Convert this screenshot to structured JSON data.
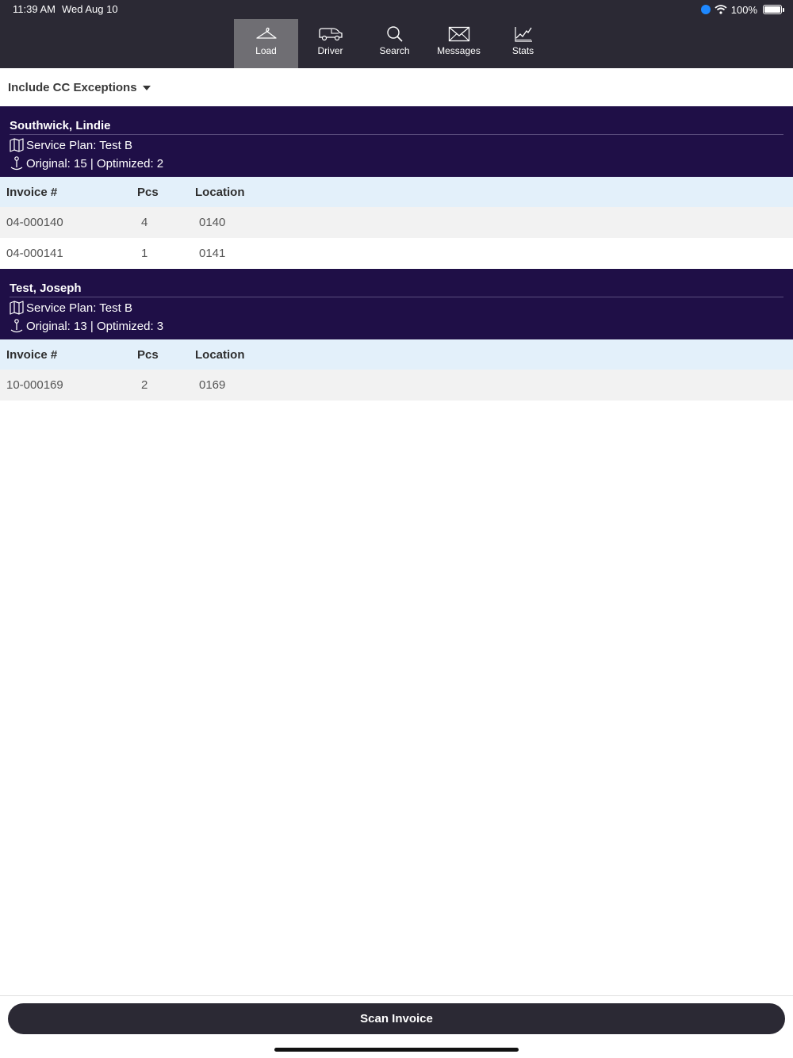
{
  "status_bar": {
    "time": "11:39 AM",
    "date": "Wed Aug 10",
    "battery": "100%"
  },
  "tabs": [
    {
      "label": "Load",
      "icon": "hanger-icon",
      "active": true
    },
    {
      "label": "Driver",
      "icon": "van-icon",
      "active": false
    },
    {
      "label": "Search",
      "icon": "search-icon",
      "active": false
    },
    {
      "label": "Messages",
      "icon": "envelope-icon",
      "active": false
    },
    {
      "label": "Stats",
      "icon": "chart-icon",
      "active": false
    }
  ],
  "filter": {
    "label": "Include CC Exceptions"
  },
  "columns": {
    "invoice": "Invoice #",
    "pcs": "Pcs",
    "location": "Location"
  },
  "groups": [
    {
      "name": "Southwick, Lindie",
      "service_plan": "Service Plan: Test B",
      "route": "Original: 15 | Optimized: 2",
      "rows": [
        {
          "invoice": "04-000140",
          "pcs": "4",
          "location": "0140"
        },
        {
          "invoice": "04-000141",
          "pcs": "1",
          "location": "0141"
        }
      ]
    },
    {
      "name": "Test, Joseph",
      "service_plan": "Service Plan: Test B",
      "route": "Original: 13 | Optimized: 3",
      "rows": [
        {
          "invoice": "10-000169",
          "pcs": "2",
          "location": "0169"
        }
      ]
    }
  ],
  "scan_button": {
    "label": "Scan Invoice"
  },
  "colors": {
    "topbar": "#2b2934",
    "active_tab": "#6f6e73",
    "group_header": "#1f0f47",
    "column_header": "#e3f0fa"
  }
}
